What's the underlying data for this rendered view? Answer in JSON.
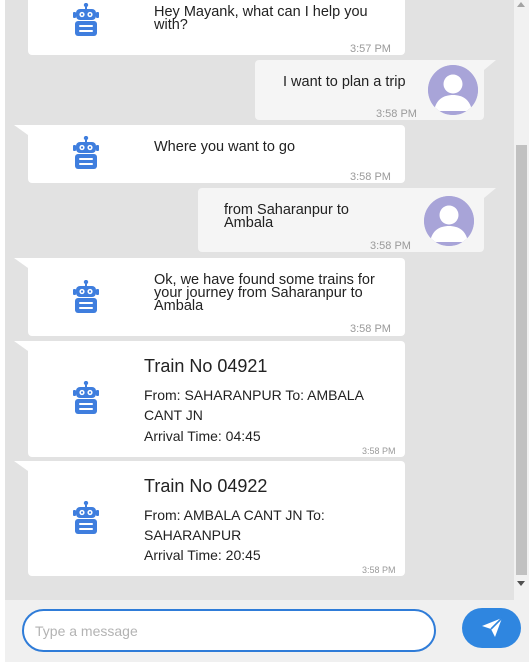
{
  "messages": [
    {
      "text": "Hey Mayank, what can I help you with?",
      "time": "3:57 PM"
    },
    {
      "text": "I want to plan a trip",
      "time": "3:58 PM"
    },
    {
      "text": "Where you want to go",
      "time": "3:58 PM"
    },
    {
      "text": "from Saharanpur to Ambala",
      "time": "3:58 PM"
    },
    {
      "text": "Ok, we have found some trains for your journey from Saharanpur to Ambala",
      "time": "3:58 PM"
    }
  ],
  "trains": [
    {
      "title": "Train No 04921",
      "route": "From: SAHARANPUR To: AMBALA CANT JN",
      "arrival": "Arrival Time: 04:45",
      "time": "3:58 PM"
    },
    {
      "title": "Train No 04922",
      "route": "From: AMBALA CANT JN To: SAHARANPUR",
      "arrival": "Arrival Time: 20:45",
      "time": "3:58 PM"
    }
  ],
  "input": {
    "placeholder": "Type a message"
  },
  "icons": {
    "bot": "robot-icon",
    "user": "user-avatar-icon",
    "send": "paper-plane-icon"
  },
  "colors": {
    "accent": "#2f86e0",
    "bot_icon": "#3f7ede",
    "user_avatar": "#a8a4d8",
    "chat_bg": "#e2e2e2"
  }
}
